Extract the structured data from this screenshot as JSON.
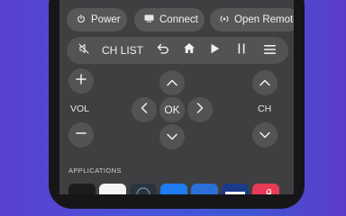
{
  "top_buttons": {
    "power_label": "Power",
    "connect_label": "Connect",
    "open_remote_label": "Open Remote"
  },
  "control_bar": {
    "ch_list_label": "CH LIST"
  },
  "volume": {
    "label": "VOL"
  },
  "channel": {
    "label": "CH"
  },
  "dpad": {
    "ok_label": "OK"
  },
  "applications": {
    "header": "APPLICATIONS"
  },
  "icons": [
    "power-icon",
    "tv-icon",
    "remote-icon",
    "mute-icon",
    "back-icon",
    "home-icon",
    "play-icon",
    "pause-icon",
    "menu-icon",
    "plus-icon",
    "minus-icon",
    "chevron-up-icon",
    "chevron-down-icon",
    "chevron-left-icon",
    "chevron-right-icon"
  ],
  "colors": {
    "background_gradient": [
      "#5a3fd0",
      "#3f57d4"
    ],
    "device_frame": "#161618",
    "screen": "#3f3f42",
    "button": "#575759",
    "accent_red": "#e83a56",
    "app_blue": "#1f7cf0"
  }
}
